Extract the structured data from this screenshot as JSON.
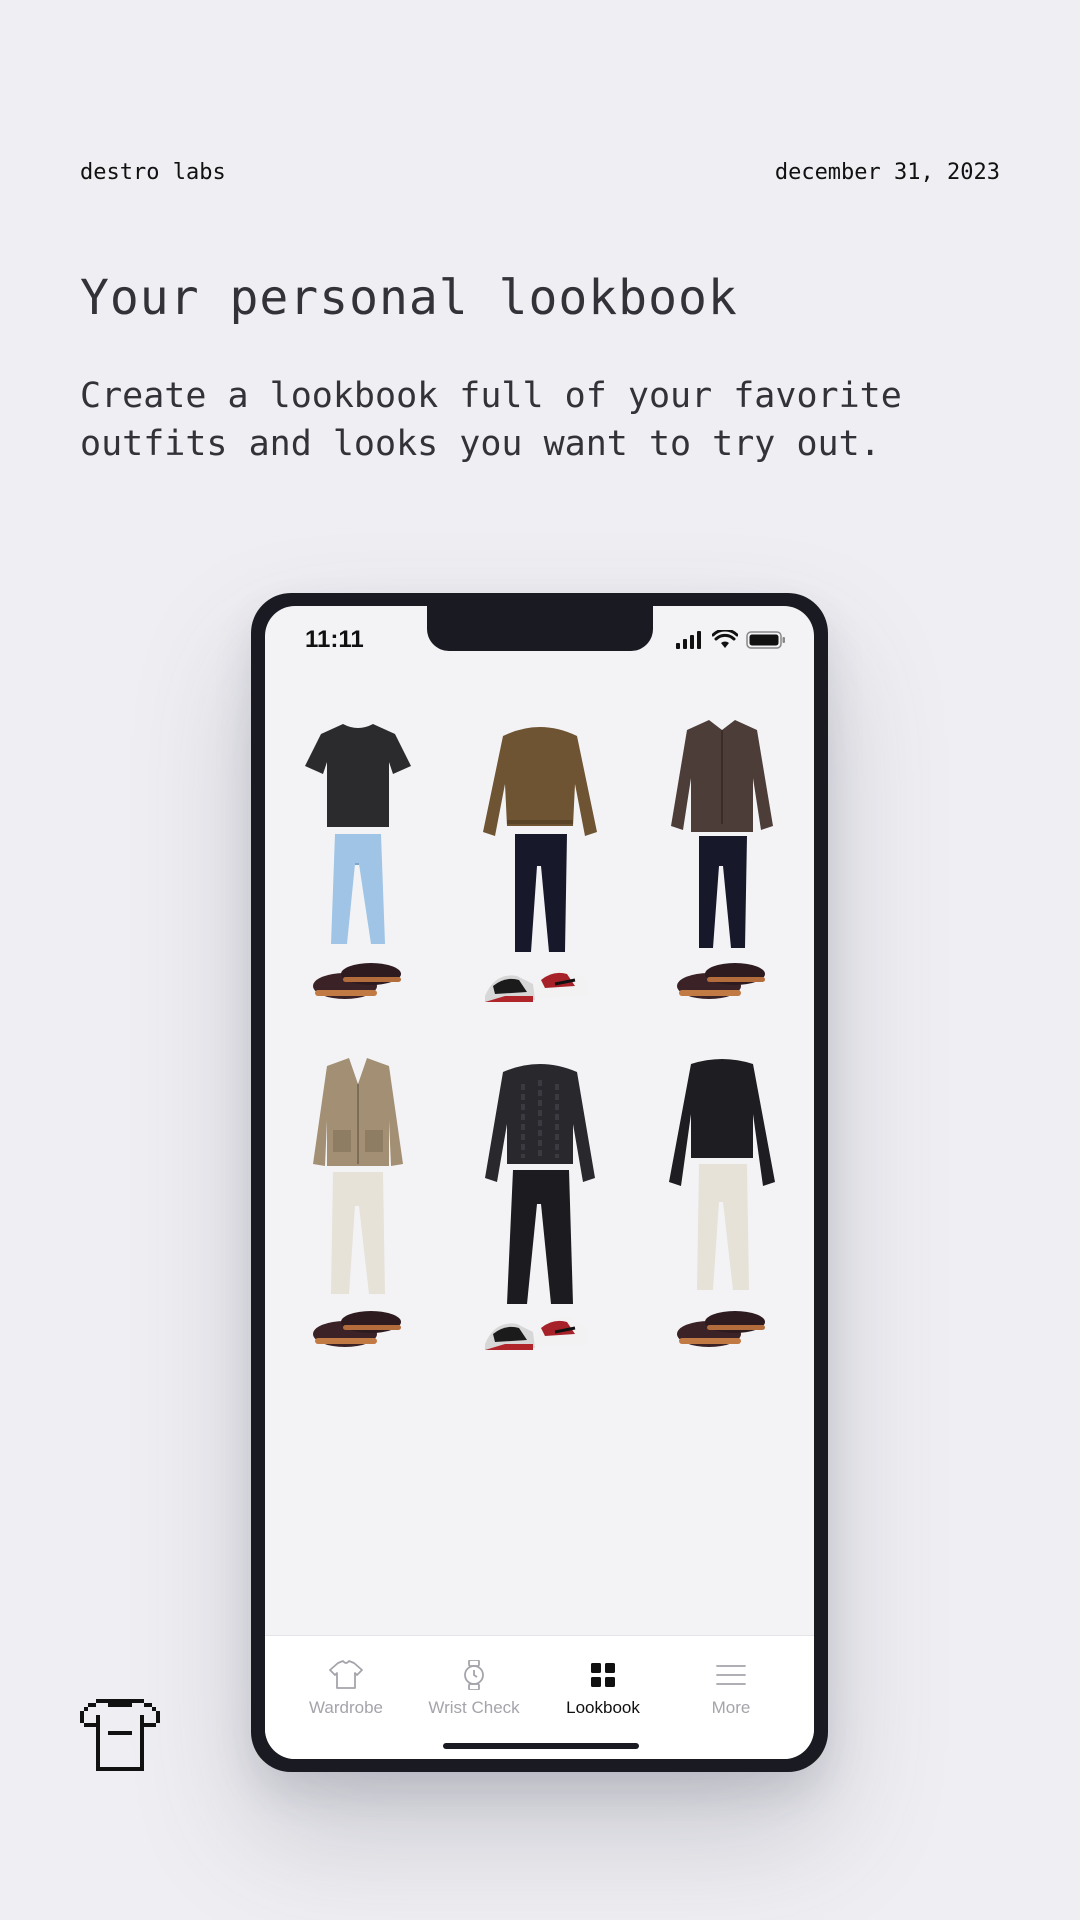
{
  "header": {
    "brand": "destro labs",
    "date": "december 31, 2023"
  },
  "hero": {
    "title": "Your personal lookbook",
    "subtitle": "Create a lookbook full of your favorite outfits and looks you want to try out."
  },
  "status_bar": {
    "time": "11:11"
  },
  "outfits": [
    {
      "top": "black t-shirt",
      "bottom": "light wash jeans",
      "shoes": "brown loafers"
    },
    {
      "top": "brown knit sweater",
      "bottom": "dark jeans",
      "shoes": "red white sneakers"
    },
    {
      "top": "brown knit polo",
      "bottom": "dark jeans",
      "shoes": "brown loafers"
    },
    {
      "top": "tan cardigan",
      "bottom": "off-white jeans",
      "shoes": "brown loafers"
    },
    {
      "top": "black cable knit sweater",
      "bottom": "black trousers",
      "shoes": "red white sneakers"
    },
    {
      "top": "black long sleeve tee",
      "bottom": "off-white jeans",
      "shoes": "brown loafers"
    }
  ],
  "tabbar": {
    "tabs": [
      {
        "label": "Wardrobe",
        "icon": "shirt-icon",
        "active": false
      },
      {
        "label": "Wrist Check",
        "icon": "watch-icon",
        "active": false
      },
      {
        "label": "Lookbook",
        "icon": "grid-icon",
        "active": true
      },
      {
        "label": "More",
        "icon": "menu-icon",
        "active": false
      }
    ]
  },
  "colors": {
    "background": "#efeff3",
    "phone_frame": "#1a1a22",
    "screen": "#f3f3f6",
    "active_tab": "#111111",
    "inactive_tab": "#a4a4ab"
  }
}
